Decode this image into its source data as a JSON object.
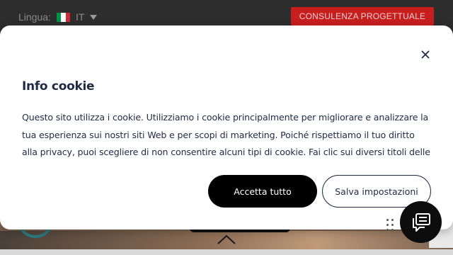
{
  "site": {
    "language_label": "Lingua:",
    "language_code": "IT",
    "flag_colors": [
      "#009246",
      "#ffffff",
      "#ce2b37"
    ],
    "consult_button": "CONSULENZA PROGETTUALE"
  },
  "cookie_modal": {
    "title": "Info cookie",
    "body": "Questo sito utilizza i cookie. Utilizziamo i cookie principalmente per migliorare e analizzare la tua esperienza sui nostri siti Web e per scopi di marketing. Poiché rispettiamo il tuo diritto alla privacy, puoi scegliere di non consentire alcuni tipi di cookie. Fai clic sui diversi titoli delle",
    "accept_all_label": "Accetta tutto",
    "save_settings_label": "Salva impostazioni",
    "close_icon": "close-icon"
  },
  "widgets": {
    "chat_icon": "chat-icon",
    "scroll_up_icon": "chevron-up-icon"
  },
  "colors": {
    "accent_red": "#c81e1e",
    "text_navy": "#1f2a44",
    "button_black": "#000000"
  }
}
